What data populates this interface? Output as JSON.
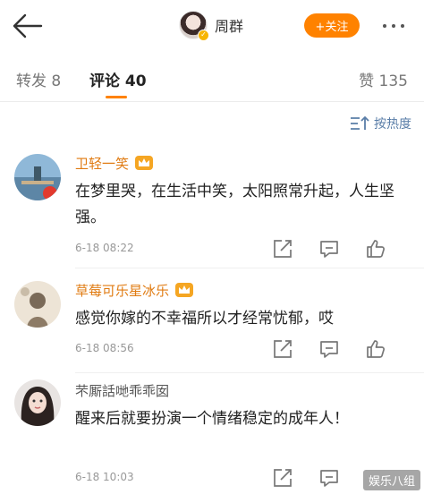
{
  "header": {
    "back_icon": "back-arrow-icon",
    "author_name": "周群",
    "follow_label": "+关注",
    "more_icon": "more-dots-icon",
    "accent": "#ff8200"
  },
  "tabs": {
    "repost_label": "转发 8",
    "comment_label": "评论 40",
    "like_label": "赞 135"
  },
  "sort": {
    "label": "按热度",
    "icon": "sort-icon",
    "color": "#5a7ea8"
  },
  "comments": [
    {
      "name": "卫轻一笑",
      "badge": "crown-icon",
      "text": "在梦里哭，在生活中笑，太阳照常升起，人生坚强。",
      "time": "6-18 08:22"
    },
    {
      "name": "草莓可乐星冰乐",
      "badge": "crown-icon",
      "text": "感觉你嫁的不幸福所以才经常忧郁，哎",
      "time": "6-18 08:56"
    },
    {
      "name": "芣厮話哋乖乖囡",
      "text": "醒来后就要扮演一个情绪稳定的成年人！",
      "time": "6-18 10:03"
    }
  ],
  "watermark": "娱乐八组"
}
